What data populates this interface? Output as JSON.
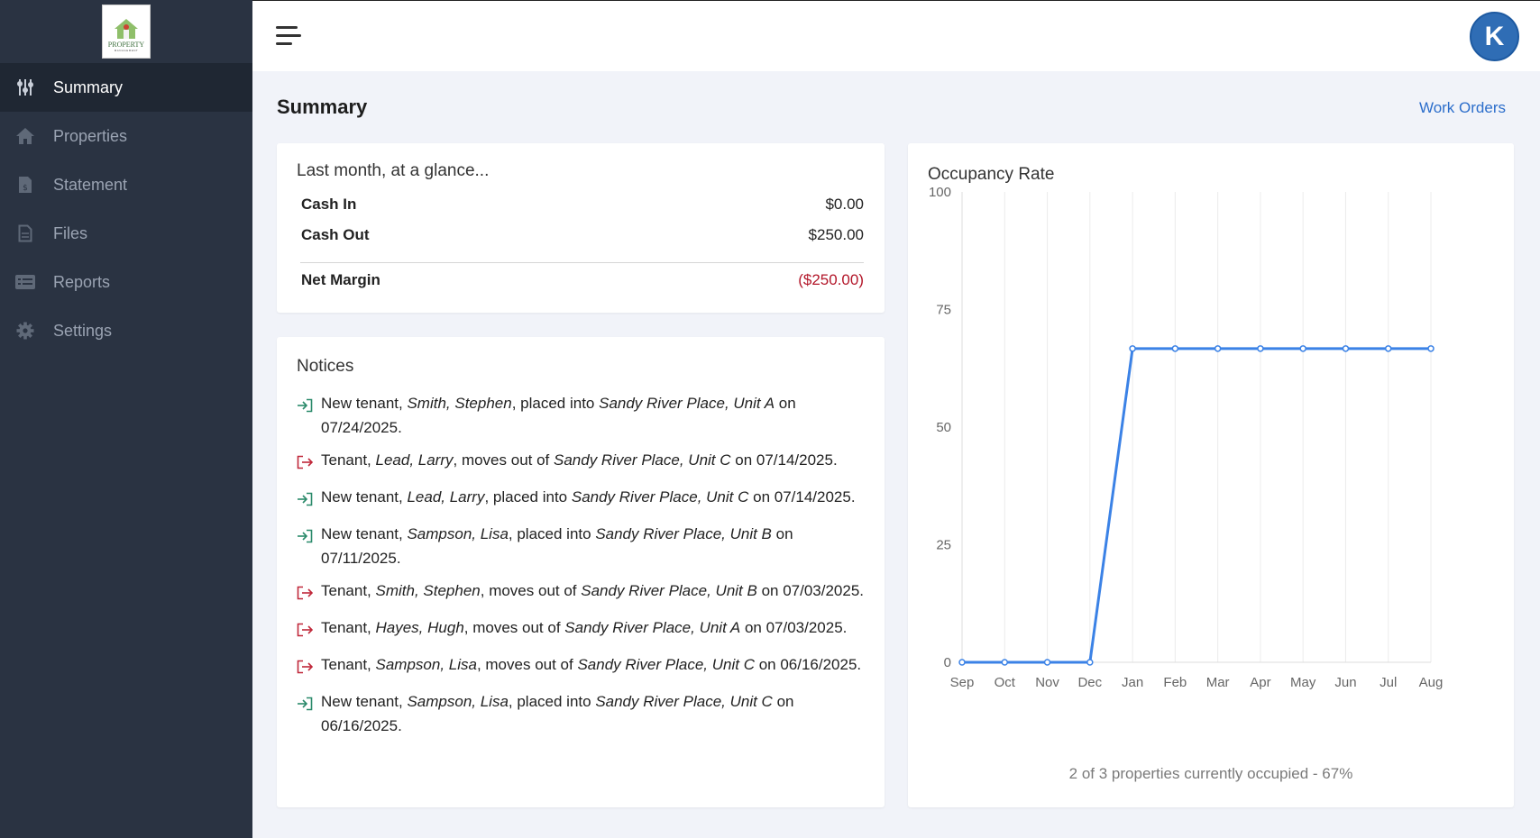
{
  "sidebar": {
    "logo": {
      "text": "PROPERTY",
      "subtext": "MANAGEMENT"
    },
    "items": [
      {
        "label": "Summary",
        "icon": "sliders-icon",
        "active": true
      },
      {
        "label": "Properties",
        "icon": "home-icon",
        "active": false
      },
      {
        "label": "Statement",
        "icon": "document-dollar-icon",
        "active": false
      },
      {
        "label": "Files",
        "icon": "file-icon",
        "active": false
      },
      {
        "label": "Reports",
        "icon": "list-card-icon",
        "active": false
      },
      {
        "label": "Settings",
        "icon": "gear-icon",
        "active": false
      }
    ]
  },
  "topbar": {
    "avatar_initial": "K"
  },
  "page": {
    "title": "Summary",
    "work_orders_link": "Work Orders"
  },
  "glance": {
    "title": "Last month, at a glance...",
    "cash_in_label": "Cash In",
    "cash_in_value": "$0.00",
    "cash_out_label": "Cash Out",
    "cash_out_value": "$250.00",
    "net_margin_label": "Net Margin",
    "net_margin_value": "($250.00)"
  },
  "notices": {
    "title": "Notices",
    "items": [
      {
        "type": "in",
        "parts": [
          [
            "New tenant, ",
            false
          ],
          [
            "Smith, Stephen",
            true
          ],
          [
            ", placed into ",
            false
          ],
          [
            "Sandy River Place, Unit A",
            true
          ],
          [
            " on 07/24/2025.",
            false
          ]
        ]
      },
      {
        "type": "out",
        "parts": [
          [
            "Tenant, ",
            false
          ],
          [
            "Lead, Larry",
            true
          ],
          [
            ", moves out of ",
            false
          ],
          [
            "Sandy River Place, Unit C",
            true
          ],
          [
            " on 07/14/2025.",
            false
          ]
        ]
      },
      {
        "type": "in",
        "parts": [
          [
            "New tenant, ",
            false
          ],
          [
            "Lead, Larry",
            true
          ],
          [
            ", placed into ",
            false
          ],
          [
            "Sandy River Place, Unit C",
            true
          ],
          [
            " on 07/14/2025.",
            false
          ]
        ]
      },
      {
        "type": "in",
        "parts": [
          [
            "New tenant, ",
            false
          ],
          [
            "Sampson, Lisa",
            true
          ],
          [
            ", placed into ",
            false
          ],
          [
            "Sandy River Place, Unit B",
            true
          ],
          [
            " on 07/11/2025.",
            false
          ]
        ]
      },
      {
        "type": "out",
        "parts": [
          [
            "Tenant, ",
            false
          ],
          [
            "Smith, Stephen",
            true
          ],
          [
            ", moves out of ",
            false
          ],
          [
            "Sandy River Place, Unit B",
            true
          ],
          [
            " on 07/03/2025.",
            false
          ]
        ]
      },
      {
        "type": "out",
        "parts": [
          [
            "Tenant, ",
            false
          ],
          [
            "Hayes, Hugh",
            true
          ],
          [
            ", moves out of ",
            false
          ],
          [
            "Sandy River Place, Unit A",
            true
          ],
          [
            " on 07/03/2025.",
            false
          ]
        ]
      },
      {
        "type": "out",
        "parts": [
          [
            "Tenant, ",
            false
          ],
          [
            "Sampson, Lisa",
            true
          ],
          [
            ", moves out of ",
            false
          ],
          [
            "Sandy River Place, Unit C",
            true
          ],
          [
            " on 06/16/2025.",
            false
          ]
        ]
      },
      {
        "type": "in",
        "parts": [
          [
            "New tenant, ",
            false
          ],
          [
            "Sampson, Lisa",
            true
          ],
          [
            ", placed into ",
            false
          ],
          [
            "Sandy River Place, Unit C",
            true
          ],
          [
            " on 06/16/2025.",
            false
          ]
        ]
      }
    ]
  },
  "chart_data": {
    "type": "line",
    "title": "Occupancy Rate",
    "categories": [
      "Sep",
      "Oct",
      "Nov",
      "Dec",
      "Jan",
      "Feb",
      "Mar",
      "Apr",
      "May",
      "Jun",
      "Jul",
      "Aug"
    ],
    "series": [
      {
        "values": [
          0,
          0,
          0,
          0,
          66.7,
          66.7,
          66.7,
          66.7,
          66.7,
          66.7,
          66.7,
          66.7
        ]
      }
    ],
    "ylim": [
      0,
      100
    ],
    "yticks": [
      0,
      25,
      50,
      75,
      100
    ],
    "grid": "vertical",
    "line_color": "#3b82e6",
    "footer": "2 of 3 properties currently occupied - 67%"
  },
  "colors": {
    "in_icon": "#2a8a6a",
    "out_icon": "#c0283a",
    "negative": "#b3172a",
    "link": "#2c6ecb"
  }
}
